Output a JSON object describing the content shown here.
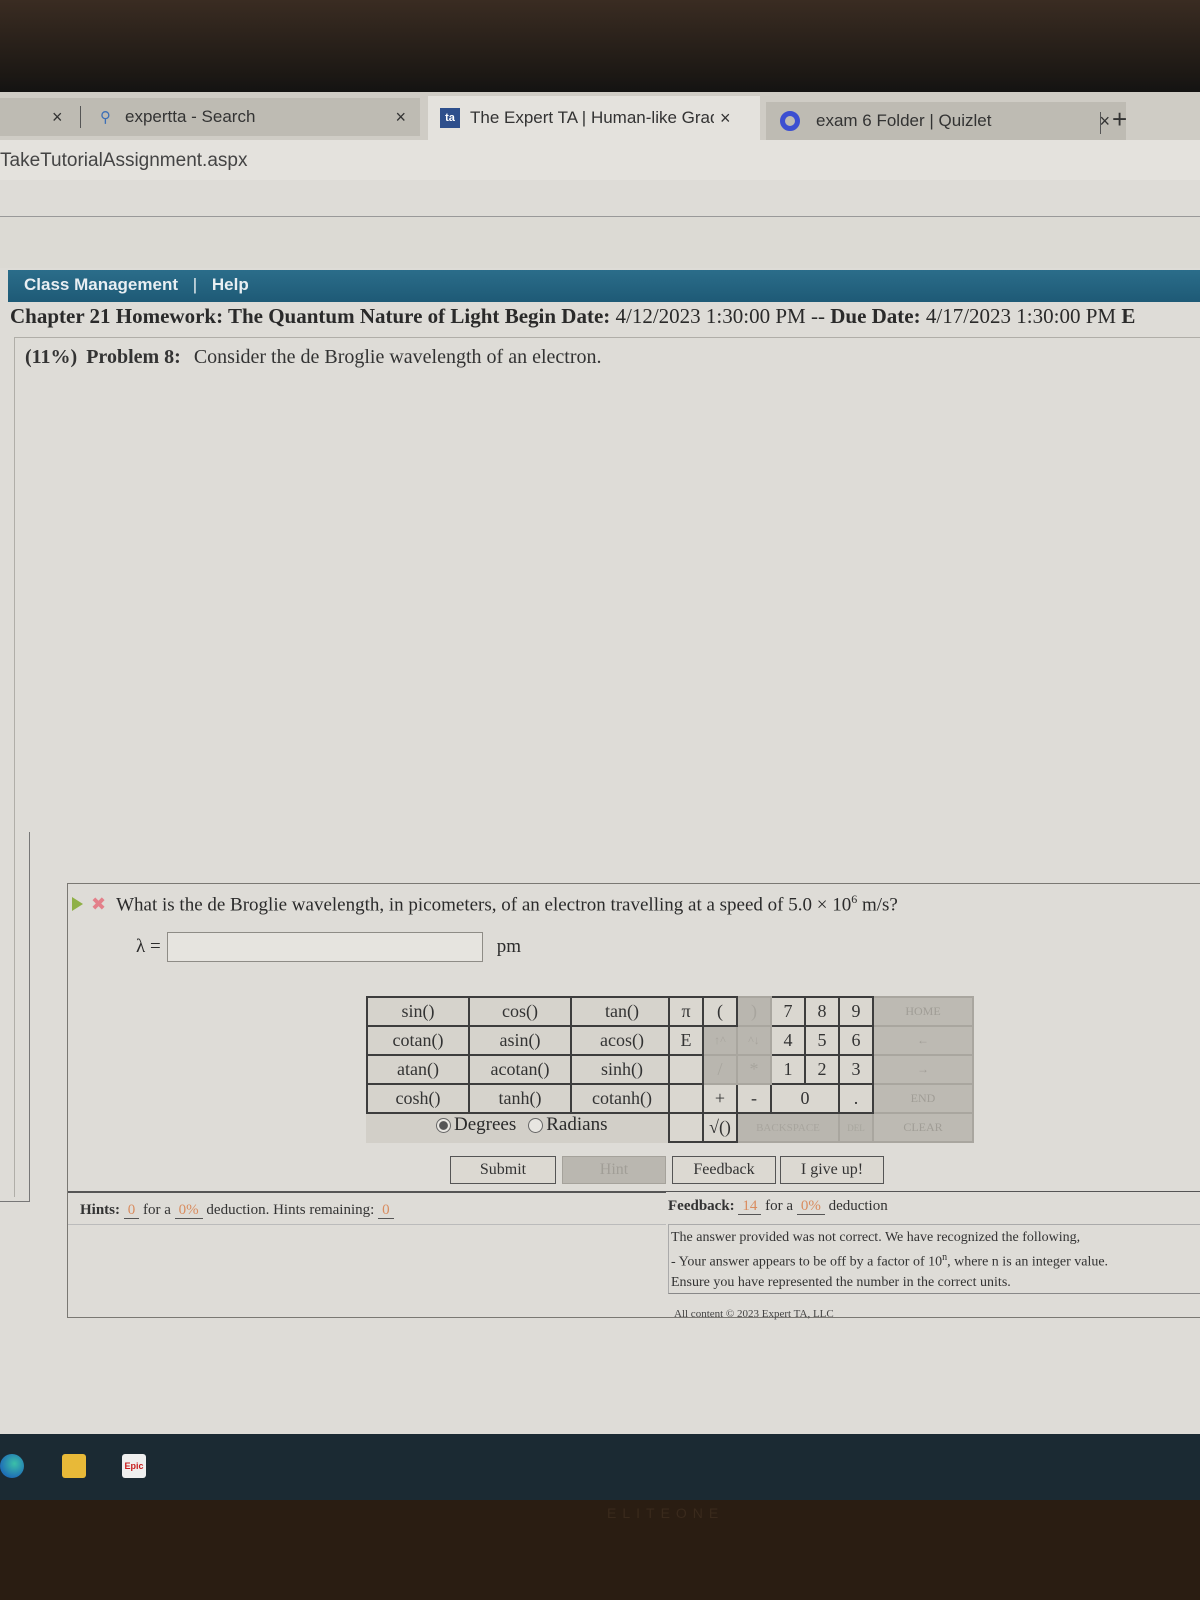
{
  "browser": {
    "tabs": [
      {
        "label": "expertta - Search",
        "icon": "search-icon",
        "active": false
      },
      {
        "label": "The Expert TA | Human-like Grad",
        "icon": "expertta-logo-icon",
        "active": true
      },
      {
        "label": "exam 6 Folder | Quizlet",
        "icon": "quizlet-logo-icon",
        "active": false
      }
    ],
    "close_glyph": "×",
    "new_tab_glyph": "+",
    "address": "TakeTutorialAssignment.aspx"
  },
  "nav": {
    "items": [
      "Class Management",
      "|",
      "Help"
    ]
  },
  "assignment": {
    "title": "Chapter 21 Homework: The Quantum Nature of Light",
    "begin_label": "Begin Date:",
    "begin_date": "4/12/2023 1:30:00 PM",
    "separator": "--",
    "due_label": "Due Date:",
    "due_date": "4/17/2023 1:30:00 PM",
    "trailing": "E"
  },
  "problem": {
    "weight": "(11%)",
    "label": "Problem 8:",
    "intro": "Consider the de Broglie wavelength of an electron.",
    "question_pre": "What is the de Broglie wavelength, in picometers, of an electron travelling at a speed of 5.0 × 10",
    "question_exp": "6",
    "question_post": " m/s?",
    "status": "incorrect",
    "answer_symbol": "λ =",
    "answer_value": "",
    "answer_unit": "pm"
  },
  "calculator": {
    "functions": [
      [
        "sin()",
        "cos()",
        "tan()"
      ],
      [
        "cotan()",
        "asin()",
        "acos()"
      ],
      [
        "atan()",
        "acotan()",
        "sinh()"
      ],
      [
        "cosh()",
        "tanh()",
        "cotanh()"
      ]
    ],
    "angle_modes": [
      "Degrees",
      "Radians"
    ],
    "angle_selected": "Degrees",
    "keys": {
      "pi": "π",
      "open_paren": "(",
      "close_paren": ")",
      "e": "E",
      "up_arrow": "↑^",
      "down_arrow": "^↓",
      "slash": "/",
      "star": "*",
      "plus": "+",
      "minus": "-",
      "sqrt": "√()",
      "backspace": "BACKSPACE",
      "del": "DEL",
      "digits": [
        "7",
        "8",
        "9",
        "4",
        "5",
        "6",
        "1",
        "2",
        "3",
        "0",
        "."
      ],
      "home": "HOME",
      "left": "←",
      "right": "→",
      "end": "END",
      "clear": "CLEAR"
    }
  },
  "buttons": {
    "submit": "Submit",
    "hint": "Hint",
    "feedback": "Feedback",
    "give_up": "I give up!"
  },
  "hints": {
    "label": "Hints:",
    "count": "0",
    "for_a": "for a",
    "deduction": "0%",
    "deduction_text": "deduction. Hints remaining:",
    "remaining": "0"
  },
  "feedback": {
    "label": "Feedback:",
    "count": "14",
    "for_a": "for a",
    "deduction": "0%",
    "deduction_text": "deduction",
    "line1": "The answer provided was not correct. We have recognized the following,",
    "line2_pre": "- Your answer appears to be off by a factor of 10",
    "line2_exp": "n",
    "line2_post": ", where n is an integer value.",
    "line3": "Ensure you have represented the number in the correct units."
  },
  "footer": {
    "copyright": "All content © 2023 Expert TA, LLC"
  },
  "taskbar": {
    "apps": [
      "edge-icon",
      "file-explorer-icon",
      "epic-icon"
    ],
    "epic_label": "Epic"
  },
  "device": {
    "brand": "ELITEONE"
  }
}
